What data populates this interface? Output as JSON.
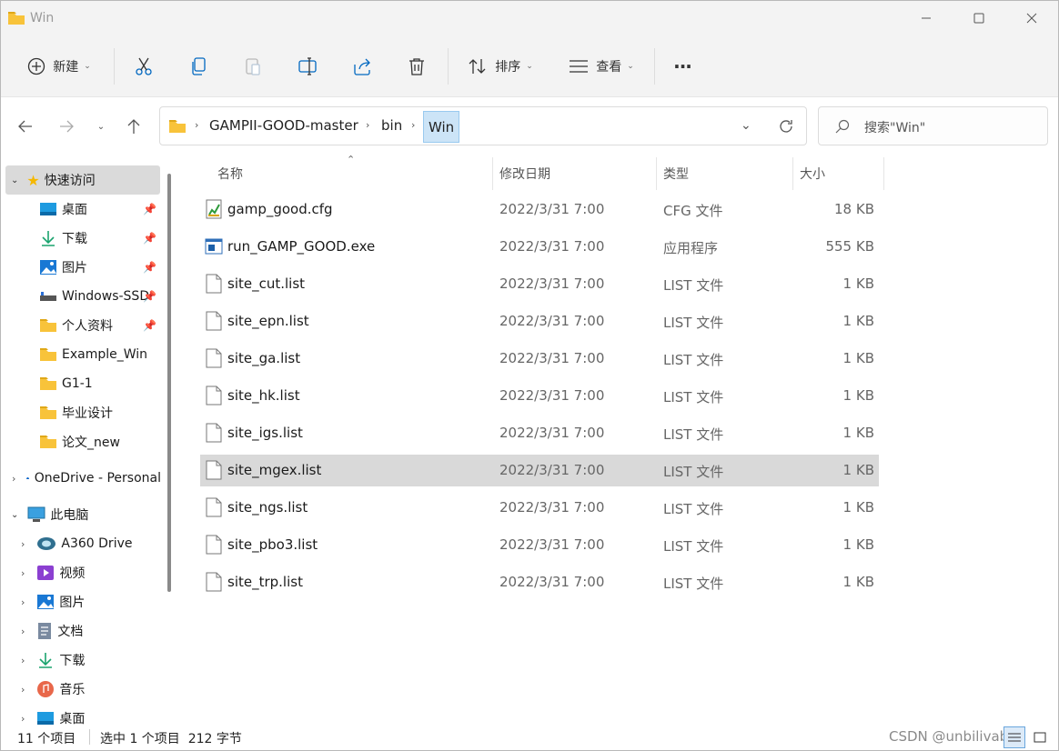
{
  "window": {
    "title": "Win"
  },
  "toolbar": {
    "new_label": "新建",
    "sort_label": "排序",
    "view_label": "查看",
    "more_label": "···"
  },
  "address": {
    "crumbs": [
      "GAMPII-GOOD-master",
      "bin",
      "Win"
    ],
    "search_placeholder": "搜索\"Win\""
  },
  "sidebar": {
    "quick_access": "快速访问",
    "quick_items": [
      {
        "label": "桌面",
        "icon": "desktop-icon",
        "pinned": true
      },
      {
        "label": "下载",
        "icon": "download-icon",
        "pinned": true
      },
      {
        "label": "图片",
        "icon": "pictures-icon",
        "pinned": true
      },
      {
        "label": "Windows-SSD",
        "icon": "drive-icon",
        "pinned": true
      },
      {
        "label": "个人资料",
        "icon": "folder-icon",
        "pinned": true
      },
      {
        "label": "Example_Win",
        "icon": "folder-icon",
        "pinned": false
      },
      {
        "label": "G1-1",
        "icon": "folder-icon",
        "pinned": false
      },
      {
        "label": "毕业设计",
        "icon": "folder-icon",
        "pinned": false
      },
      {
        "label": "论文_new",
        "icon": "folder-icon",
        "pinned": false
      }
    ],
    "onedrive": "OneDrive - Personal",
    "this_pc": "此电脑",
    "pc_items": [
      {
        "label": "A360 Drive",
        "icon": "a360-icon"
      },
      {
        "label": "视频",
        "icon": "videos-icon"
      },
      {
        "label": "图片",
        "icon": "pictures-icon"
      },
      {
        "label": "文档",
        "icon": "documents-icon"
      },
      {
        "label": "下载",
        "icon": "download-icon"
      },
      {
        "label": "音乐",
        "icon": "music-icon"
      },
      {
        "label": "桌面",
        "icon": "desktop-icon"
      }
    ]
  },
  "columns": {
    "name": "名称",
    "date": "修改日期",
    "type": "类型",
    "size": "大小"
  },
  "files": [
    {
      "name": "gamp_good.cfg",
      "date": "2022/3/31 7:00",
      "type": "CFG 文件",
      "size": "18 KB",
      "icon": "cfg"
    },
    {
      "name": "run_GAMP_GOOD.exe",
      "date": "2022/3/31 7:00",
      "type": "应用程序",
      "size": "555 KB",
      "icon": "exe"
    },
    {
      "name": "site_cut.list",
      "date": "2022/3/31 7:00",
      "type": "LIST 文件",
      "size": "1 KB",
      "icon": "file"
    },
    {
      "name": "site_epn.list",
      "date": "2022/3/31 7:00",
      "type": "LIST 文件",
      "size": "1 KB",
      "icon": "file"
    },
    {
      "name": "site_ga.list",
      "date": "2022/3/31 7:00",
      "type": "LIST 文件",
      "size": "1 KB",
      "icon": "file"
    },
    {
      "name": "site_hk.list",
      "date": "2022/3/31 7:00",
      "type": "LIST 文件",
      "size": "1 KB",
      "icon": "file"
    },
    {
      "name": "site_igs.list",
      "date": "2022/3/31 7:00",
      "type": "LIST 文件",
      "size": "1 KB",
      "icon": "file"
    },
    {
      "name": "site_mgex.list",
      "date": "2022/3/31 7:00",
      "type": "LIST 文件",
      "size": "1 KB",
      "icon": "file",
      "selected": true
    },
    {
      "name": "site_ngs.list",
      "date": "2022/3/31 7:00",
      "type": "LIST 文件",
      "size": "1 KB",
      "icon": "file"
    },
    {
      "name": "site_pbo3.list",
      "date": "2022/3/31 7:00",
      "type": "LIST 文件",
      "size": "1 KB",
      "icon": "file"
    },
    {
      "name": "site_trp.list",
      "date": "2022/3/31 7:00",
      "type": "LIST 文件",
      "size": "1 KB",
      "icon": "file"
    }
  ],
  "status": {
    "count": "11 个项目",
    "selection": "选中 1 个项目  212 字节",
    "watermark": "CSDN @unbilivable"
  },
  "colors": {
    "accent": "#0078d4",
    "folder": "#f8c33a",
    "selected_row": "#d9d9d9",
    "sidebar_selected": "#dadada"
  }
}
